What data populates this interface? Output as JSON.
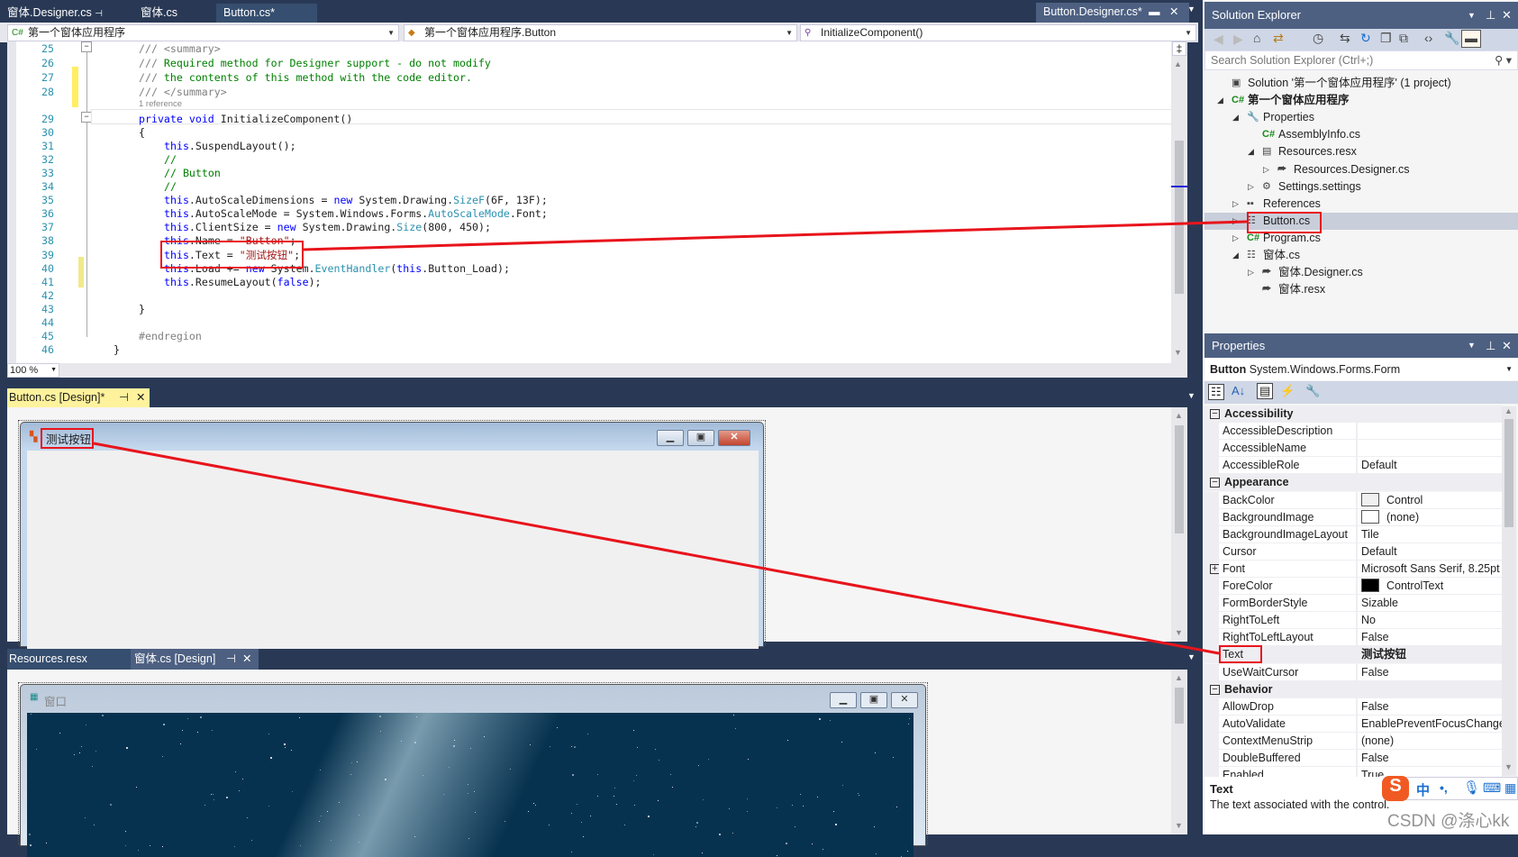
{
  "doc_tabs": [
    {
      "label": "窗体.Designer.cs",
      "pin": "⊣"
    },
    {
      "label": "窗体.cs"
    },
    {
      "label": "Button.cs*"
    }
  ],
  "active_tab": {
    "label": "Button.Designer.cs*"
  },
  "nav": {
    "project": "第一个窗体应用程序",
    "class": "第一个窗体应用程序.Button",
    "member": "InitializeComponent()"
  },
  "code_lines": [
    {
      "n": "25",
      "i": 4,
      "seg": [
        [
          "/// ",
          "g"
        ],
        [
          "<summary>",
          "g"
        ]
      ]
    },
    {
      "n": "26",
      "i": 4,
      "seg": [
        [
          "/// ",
          "g"
        ],
        [
          "Required method for Designer support - do not modify",
          "c"
        ]
      ]
    },
    {
      "n": "27",
      "i": 4,
      "seg": [
        [
          "/// ",
          "g"
        ],
        [
          "the contents of this method with the code editor.",
          "c"
        ]
      ]
    },
    {
      "n": "28",
      "i": 4,
      "seg": [
        [
          "/// ",
          "g"
        ],
        [
          "</summary>",
          "g"
        ]
      ]
    },
    {
      "n": "",
      "i": 4,
      "ref": "1 reference"
    },
    {
      "n": "29",
      "i": 4,
      "seg": [
        [
          "private",
          "k"
        ],
        [
          " "
        ],
        [
          "void",
          "k"
        ],
        [
          " InitializeComponent()"
        ]
      ]
    },
    {
      "n": "30",
      "i": 4,
      "seg": [
        [
          "{"
        ]
      ]
    },
    {
      "n": "31",
      "i": 8,
      "seg": [
        [
          "this",
          "k"
        ],
        [
          ".SuspendLayout();"
        ]
      ]
    },
    {
      "n": "32",
      "i": 8,
      "seg": [
        [
          "//",
          "c"
        ]
      ]
    },
    {
      "n": "33",
      "i": 8,
      "seg": [
        [
          "// Button",
          "c"
        ]
      ]
    },
    {
      "n": "34",
      "i": 8,
      "seg": [
        [
          "//",
          "c"
        ]
      ]
    },
    {
      "n": "35",
      "i": 8,
      "seg": [
        [
          "this",
          "k"
        ],
        [
          ".AutoScaleDimensions = "
        ],
        [
          "new",
          "k"
        ],
        [
          " System.Drawing."
        ],
        [
          "SizeF",
          "t"
        ],
        [
          "(6F, 13F);"
        ]
      ]
    },
    {
      "n": "36",
      "i": 8,
      "seg": [
        [
          "this",
          "k"
        ],
        [
          ".AutoScaleMode = System.Windows.Forms."
        ],
        [
          "AutoScaleMode",
          "t"
        ],
        [
          ".Font;"
        ]
      ]
    },
    {
      "n": "37",
      "i": 8,
      "seg": [
        [
          "this",
          "k"
        ],
        [
          ".ClientSize = "
        ],
        [
          "new",
          "k"
        ],
        [
          " System.Drawing."
        ],
        [
          "Size",
          "t"
        ],
        [
          "(800, 450);"
        ]
      ]
    },
    {
      "n": "38",
      "i": 8,
      "seg": [
        [
          "this",
          "k"
        ],
        [
          ".Name = "
        ],
        [
          "\"Button\"",
          "s"
        ],
        [
          ";"
        ]
      ]
    },
    {
      "n": "39",
      "i": 8,
      "seg": [
        [
          "this",
          "k"
        ],
        [
          ".Text = "
        ],
        [
          "\"测试按钮\"",
          "s"
        ],
        [
          ";"
        ]
      ]
    },
    {
      "n": "40",
      "i": 8,
      "seg": [
        [
          "this",
          "k"
        ],
        [
          ".Load += "
        ],
        [
          "new",
          "k"
        ],
        [
          " System."
        ],
        [
          "EventHandler",
          "t"
        ],
        [
          "("
        ],
        [
          "this",
          "k"
        ],
        [
          ".Button_Load);"
        ]
      ]
    },
    {
      "n": "41",
      "i": 8,
      "seg": [
        [
          "this",
          "k"
        ],
        [
          ".ResumeLayout("
        ],
        [
          "false",
          "k"
        ],
        [
          ");"
        ]
      ]
    },
    {
      "n": "42",
      "i": 0,
      "seg": []
    },
    {
      "n": "43",
      "i": 4,
      "seg": [
        [
          "}"
        ]
      ]
    },
    {
      "n": "44",
      "i": 0,
      "seg": []
    },
    {
      "n": "45",
      "i": 4,
      "seg": [
        [
          "#endregion",
          "g"
        ]
      ]
    },
    {
      "n": "46",
      "i": 0,
      "seg": [
        [
          "}"
        ]
      ]
    }
  ],
  "zoom_level": "100 %",
  "designer1": {
    "tab": "Button.cs [Design]*",
    "form_title": "测试按钮"
  },
  "designer2": {
    "tabs": [
      "Resources.resx",
      "窗体.cs [Design]"
    ],
    "form_title": "窗口"
  },
  "solution_explorer": {
    "title": "Solution Explorer",
    "search_placeholder": "Search Solution Explorer (Ctrl+;)",
    "items": [
      {
        "label": "Solution '第一个窗体应用程序' (1 project)",
        "d": 0,
        "exp": "",
        "icon": "vs-solution-icon",
        "glyph": "▣"
      },
      {
        "label": "第一个窗体应用程序",
        "d": 0,
        "exp": "◢",
        "icon": "csharp-project-icon",
        "glyph": "C#",
        "bold": true
      },
      {
        "label": "Properties",
        "d": 1,
        "exp": "◢",
        "icon": "wrench-icon",
        "glyph": "🔧"
      },
      {
        "label": "AssemblyInfo.cs",
        "d": 2,
        "exp": "",
        "icon": "csharp-file-icon",
        "glyph": "C#"
      },
      {
        "label": "Resources.resx",
        "d": 2,
        "exp": "◢",
        "icon": "resource-file-icon",
        "glyph": "▤"
      },
      {
        "label": "Resources.Designer.cs",
        "d": 3,
        "exp": "▷",
        "icon": "designer-file-icon",
        "glyph": "⮫"
      },
      {
        "label": "Settings.settings",
        "d": 2,
        "exp": "▷",
        "icon": "settings-gear-icon",
        "glyph": "⚙"
      },
      {
        "label": "References",
        "d": 1,
        "exp": "▷",
        "icon": "references-icon",
        "glyph": "▪▪"
      },
      {
        "label": "Button.cs",
        "d": 1,
        "exp": "▷",
        "icon": "form-file-icon",
        "glyph": "☷",
        "selected": true
      },
      {
        "label": "Program.cs",
        "d": 1,
        "exp": "▷",
        "icon": "csharp-file-icon",
        "glyph": "C#"
      },
      {
        "label": "窗体.cs",
        "d": 1,
        "exp": "◢",
        "icon": "form-file-icon",
        "glyph": "☷"
      },
      {
        "label": "窗体.Designer.cs",
        "d": 2,
        "exp": "▷",
        "icon": "designer-file-icon",
        "glyph": "⮫"
      },
      {
        "label": "窗体.resx",
        "d": 2,
        "exp": "",
        "icon": "designer-file-icon",
        "glyph": "⮫"
      }
    ]
  },
  "properties": {
    "title": "Properties",
    "object_name": "Button",
    "object_type": "System.Windows.Forms.Form",
    "rows": [
      {
        "cat": "Accessibility"
      },
      {
        "name": "AccessibleDescription",
        "value": ""
      },
      {
        "name": "AccessibleName",
        "value": ""
      },
      {
        "name": "AccessibleRole",
        "value": "Default"
      },
      {
        "cat": "Appearance"
      },
      {
        "name": "BackColor",
        "value": "Control",
        "swatch": "#f0f0f0"
      },
      {
        "name": "BackgroundImage",
        "value": "(none)",
        "swatch": "#ffffff"
      },
      {
        "name": "BackgroundImageLayout",
        "value": "Tile"
      },
      {
        "name": "Cursor",
        "value": "Default"
      },
      {
        "name": "Font",
        "value": "Microsoft Sans Serif, 8.25pt",
        "expand": true
      },
      {
        "name": "ForeColor",
        "value": "ControlText",
        "swatch": "#000000"
      },
      {
        "name": "FormBorderStyle",
        "value": "Sizable"
      },
      {
        "name": "RightToLeft",
        "value": "No"
      },
      {
        "name": "RightToLeftLayout",
        "value": "False"
      },
      {
        "name": "Text",
        "value": "测试按钮",
        "selected": true,
        "boldval": true
      },
      {
        "name": "UseWaitCursor",
        "value": "False"
      },
      {
        "cat": "Behavior"
      },
      {
        "name": "AllowDrop",
        "value": "False"
      },
      {
        "name": "AutoValidate",
        "value": "EnablePreventFocusChange"
      },
      {
        "name": "ContextMenuStrip",
        "value": "(none)"
      },
      {
        "name": "DoubleBuffered",
        "value": "False"
      },
      {
        "name": "Enabled",
        "value": "True"
      }
    ],
    "desc_title": "Text",
    "desc_text": "The text associated with the control."
  },
  "ime_bar": {
    "mode": "中",
    "punct": "•,"
  },
  "watermark": "CSDN @涤心kk",
  "colors": {
    "highlight": "#e8141c",
    "chrome": "#293955",
    "selected": "#c9cedb"
  }
}
